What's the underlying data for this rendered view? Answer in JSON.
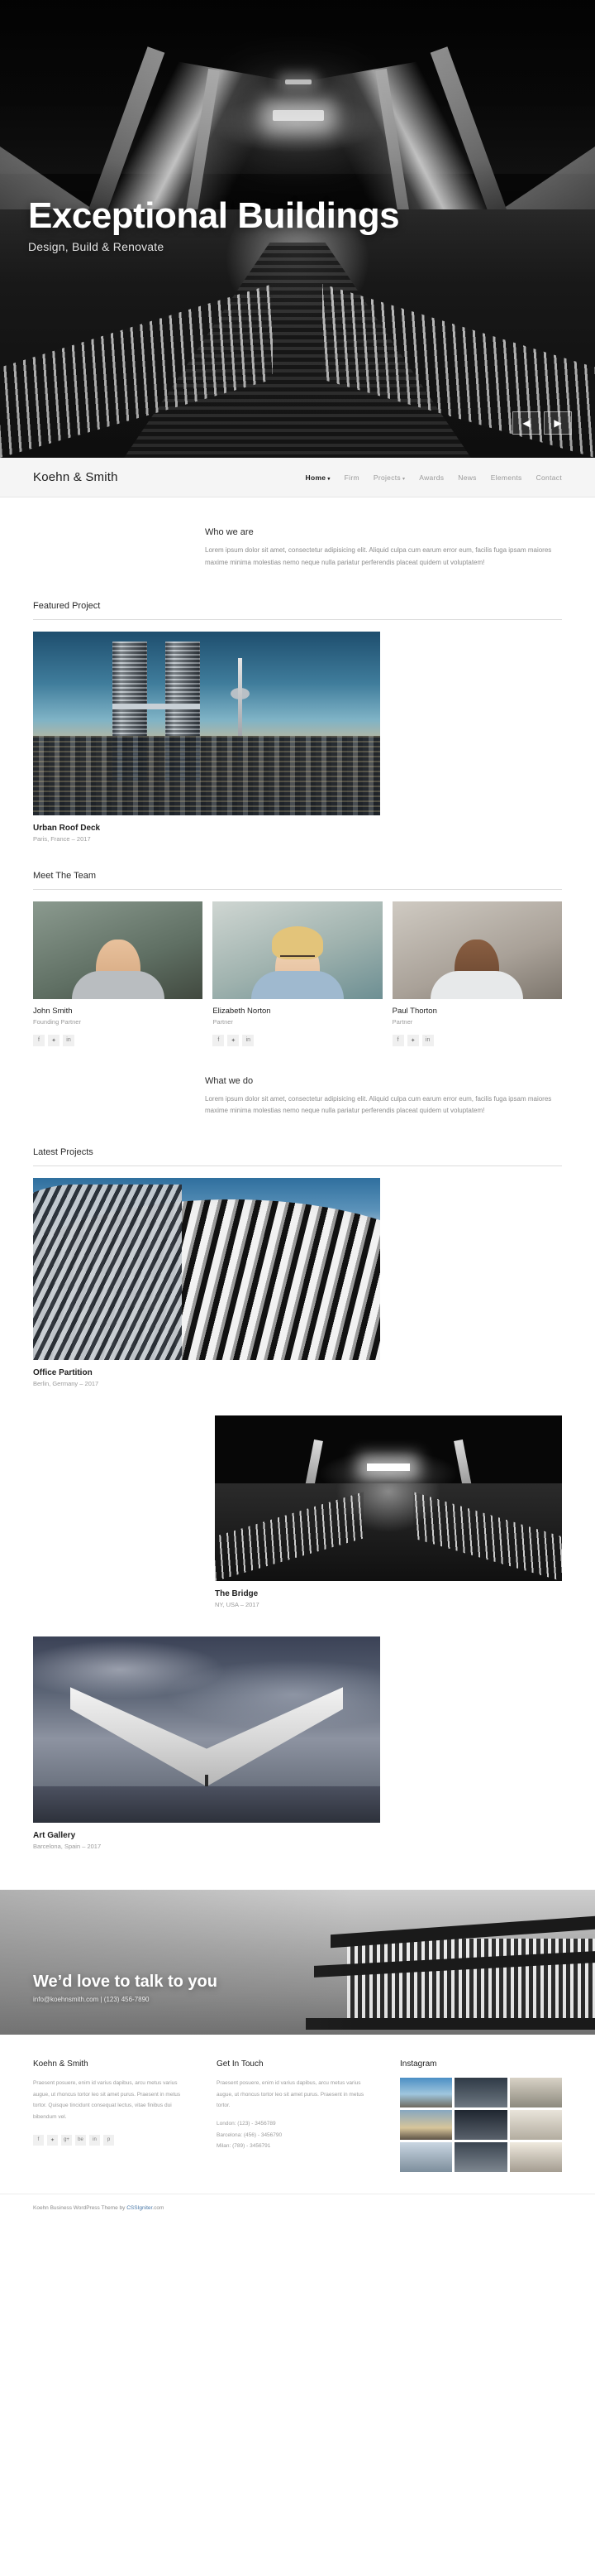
{
  "hero": {
    "title": "Exceptional Buildings",
    "subtitle": "Design, Build & Renovate",
    "prev_label": "◀",
    "next_label": "▶"
  },
  "nav": {
    "brand": "Koehn & Smith",
    "items": [
      {
        "label": "Home",
        "caret": "▾",
        "active": true
      },
      {
        "label": "Firm",
        "caret": "",
        "active": false
      },
      {
        "label": "Projects",
        "caret": "▾",
        "active": false
      },
      {
        "label": "Awards",
        "caret": "",
        "active": false
      },
      {
        "label": "News",
        "caret": "",
        "active": false
      },
      {
        "label": "Elements",
        "caret": "",
        "active": false
      },
      {
        "label": "Contact",
        "caret": "",
        "active": false
      }
    ]
  },
  "who_we_are": {
    "heading": "Who we are",
    "body": "Lorem ipsum dolor sit amet, consectetur adipisicing elit. Aliquid culpa cum earum error eum, facilis fuga ipsam maiores maxime minima molestias nemo neque nulla pariatur perferendis placeat quidem ut voluptatem!"
  },
  "featured": {
    "heading": "Featured Project",
    "title": "Urban Roof Deck",
    "meta": "Paris, France – 2017"
  },
  "team": {
    "heading": "Meet The Team",
    "members": [
      {
        "name": "John Smith",
        "role": "Founding Partner",
        "facebook": "f",
        "twitter": "🐦",
        "linkedin": "in"
      },
      {
        "name": "Elizabeth Norton",
        "role": "Partner",
        "facebook": "f",
        "twitter": "🐦",
        "linkedin": "in"
      },
      {
        "name": "Paul Thorton",
        "role": "Partner",
        "facebook": "f",
        "twitter": "🐦",
        "linkedin": "in"
      }
    ]
  },
  "what_we_do": {
    "heading": "What we do",
    "body": "Lorem ipsum dolor sit amet, consectetur adipisicing elit. Aliquid culpa cum earum error eum, facilis fuga ipsam maiores maxime minima molestias nemo neque nulla pariatur perferendis placeat quidem ut voluptatem!"
  },
  "latest_projects": {
    "heading": "Latest Projects",
    "items": [
      {
        "title": "Office Partition",
        "meta": "Berlin, Germany – 2017"
      },
      {
        "title": "The Bridge",
        "meta": "NY, USA – 2017"
      },
      {
        "title": "Art Gallery",
        "meta": "Barcelona, Spain – 2017"
      }
    ]
  },
  "cta": {
    "title": "We’d love to talk to you",
    "subtitle": "info@koehnsmith.com  |  (123) 456-7890"
  },
  "footer": {
    "about": {
      "heading": "Koehn & Smith",
      "body": "Praesent posuere, enim id varius dapibus, arcu metus varius augue, ut rhoncus tortor leo sit amet purus. Praesent in metus tortor. Quisque tincidunt consequat lectus, vitae finibus dui bibendum vel.",
      "socials": [
        "f",
        "🐦",
        "g+",
        "be",
        "in",
        "p"
      ]
    },
    "contact": {
      "heading": "Get In Touch",
      "body": "Praesent posuere, enim id varius dapibus, arcu metus varius augue, ut rhoncus tortor leo sit amet purus. Praesent in metus tortor.",
      "phones": [
        "London: (123) - 3456789",
        "Barcelona: (456) - 3456790",
        "Milan: (789) - 3456791"
      ]
    },
    "instagram": {
      "heading": "Instagram"
    }
  },
  "copyright": {
    "prefix": "Koehn Business WordPress Theme by ",
    "link": "CSSIgniter",
    "suffix": ".com"
  }
}
